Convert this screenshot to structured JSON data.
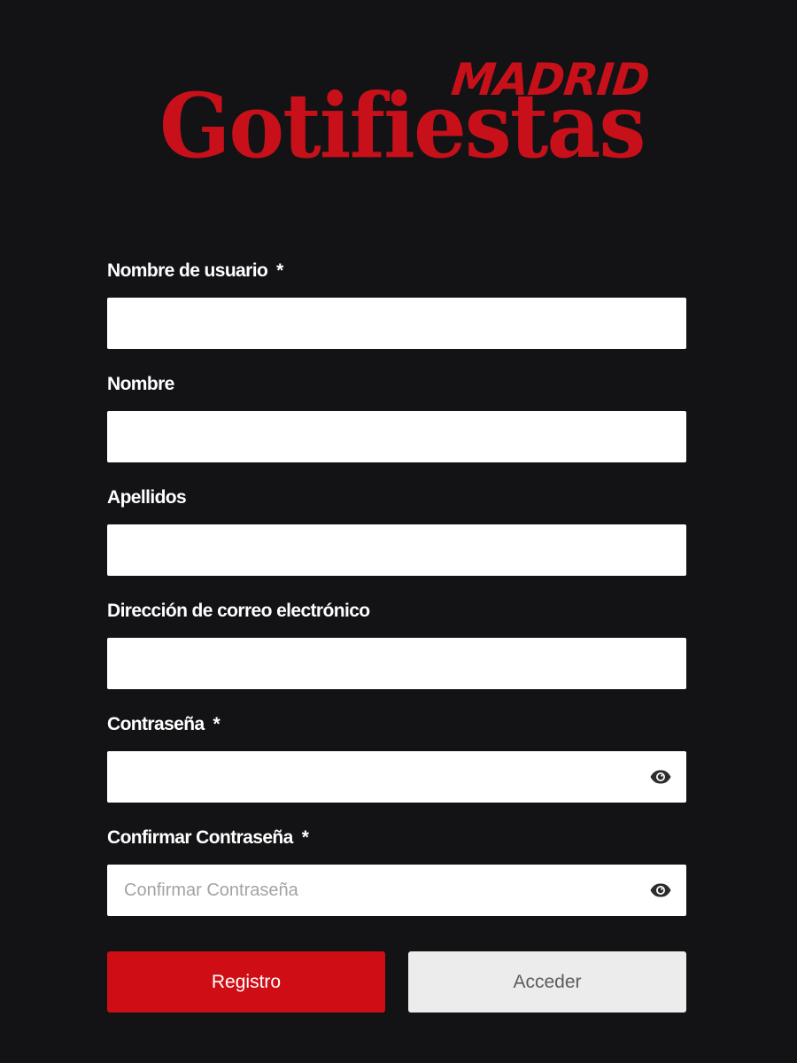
{
  "logo": {
    "main": "Gotifiestas",
    "sub": "MADRID"
  },
  "form": {
    "fields": [
      {
        "label": "Nombre de usuario",
        "required": "*",
        "value": "",
        "placeholder": ""
      },
      {
        "label": "Nombre",
        "value": "",
        "placeholder": ""
      },
      {
        "label": "Apellidos",
        "value": "",
        "placeholder": ""
      },
      {
        "label": "Dirección de correo electrónico",
        "value": "",
        "placeholder": ""
      },
      {
        "label": "Contraseña",
        "required": "*",
        "value": "",
        "placeholder": "",
        "icon": "eye-icon"
      },
      {
        "label": "Confirmar Contraseña",
        "required": "*",
        "value": "",
        "placeholder": "Confirmar Contraseña",
        "icon": "eye-icon"
      }
    ]
  },
  "buttons": {
    "register_label": "Registro",
    "login_label": "Acceder"
  },
  "colors": {
    "background": "#131315",
    "brand": "#c8101a",
    "primary_button": "#cf0d15",
    "secondary_button": "#ececec"
  }
}
